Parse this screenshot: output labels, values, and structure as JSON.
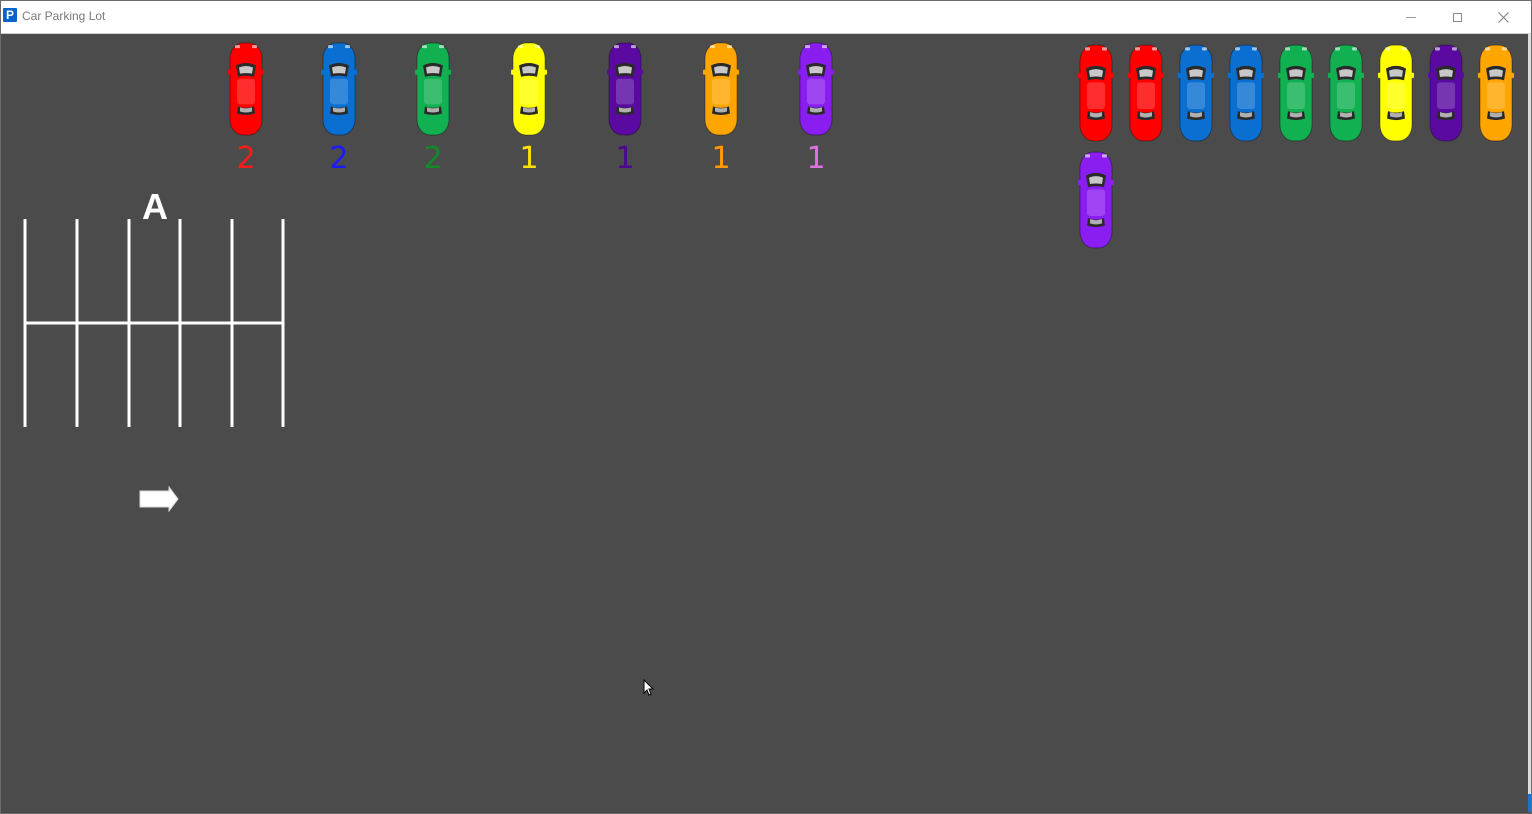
{
  "window": {
    "title": "Car Parking Lot",
    "app_icon_letter": "P"
  },
  "lot": {
    "background_color": "#4b4b4b",
    "zone_label": "A"
  },
  "colors": {
    "red": "#ff0000",
    "blue": "#0a6fd0",
    "green": "#11b050",
    "yellow": "#ffff00",
    "indigo": "#5a0aa0",
    "orange": "#ffa500",
    "purple": "#8a1ef0"
  },
  "color_counts": [
    {
      "color": "red",
      "car_color": "#ff0000",
      "label_color": "#ff1a1a",
      "count": "2"
    },
    {
      "color": "blue",
      "car_color": "#0a6fd0",
      "label_color": "#1a1aff",
      "count": "2"
    },
    {
      "color": "green",
      "car_color": "#11b050",
      "label_color": "#128a2a",
      "count": "2"
    },
    {
      "color": "yellow",
      "car_color": "#ffff00",
      "label_color": "#ffe000",
      "count": "1"
    },
    {
      "color": "indigo",
      "car_color": "#5a0aa0",
      "label_color": "#4a0a8a",
      "count": "1"
    },
    {
      "color": "orange",
      "car_color": "#ffa500",
      "label_color": "#ff9a00",
      "count": "1"
    },
    {
      "color": "purple",
      "car_color": "#8a1ef0",
      "label_color": "#e070e0",
      "count": "1"
    }
  ],
  "queue": [
    {
      "color": "red",
      "car_color": "#ff0000"
    },
    {
      "color": "red",
      "car_color": "#ff0000"
    },
    {
      "color": "blue",
      "car_color": "#0a6fd0"
    },
    {
      "color": "blue",
      "car_color": "#0a6fd0"
    },
    {
      "color": "green",
      "car_color": "#11b050"
    },
    {
      "color": "green",
      "car_color": "#11b050"
    },
    {
      "color": "yellow",
      "car_color": "#ffff00"
    },
    {
      "color": "indigo",
      "car_color": "#5a0aa0"
    },
    {
      "color": "orange",
      "car_color": "#ffa500"
    },
    {
      "color": "purple",
      "car_color": "#8a1ef0"
    }
  ],
  "icons": {
    "arrow": "right-arrow-icon",
    "cursor": "mouse-pointer-icon"
  }
}
